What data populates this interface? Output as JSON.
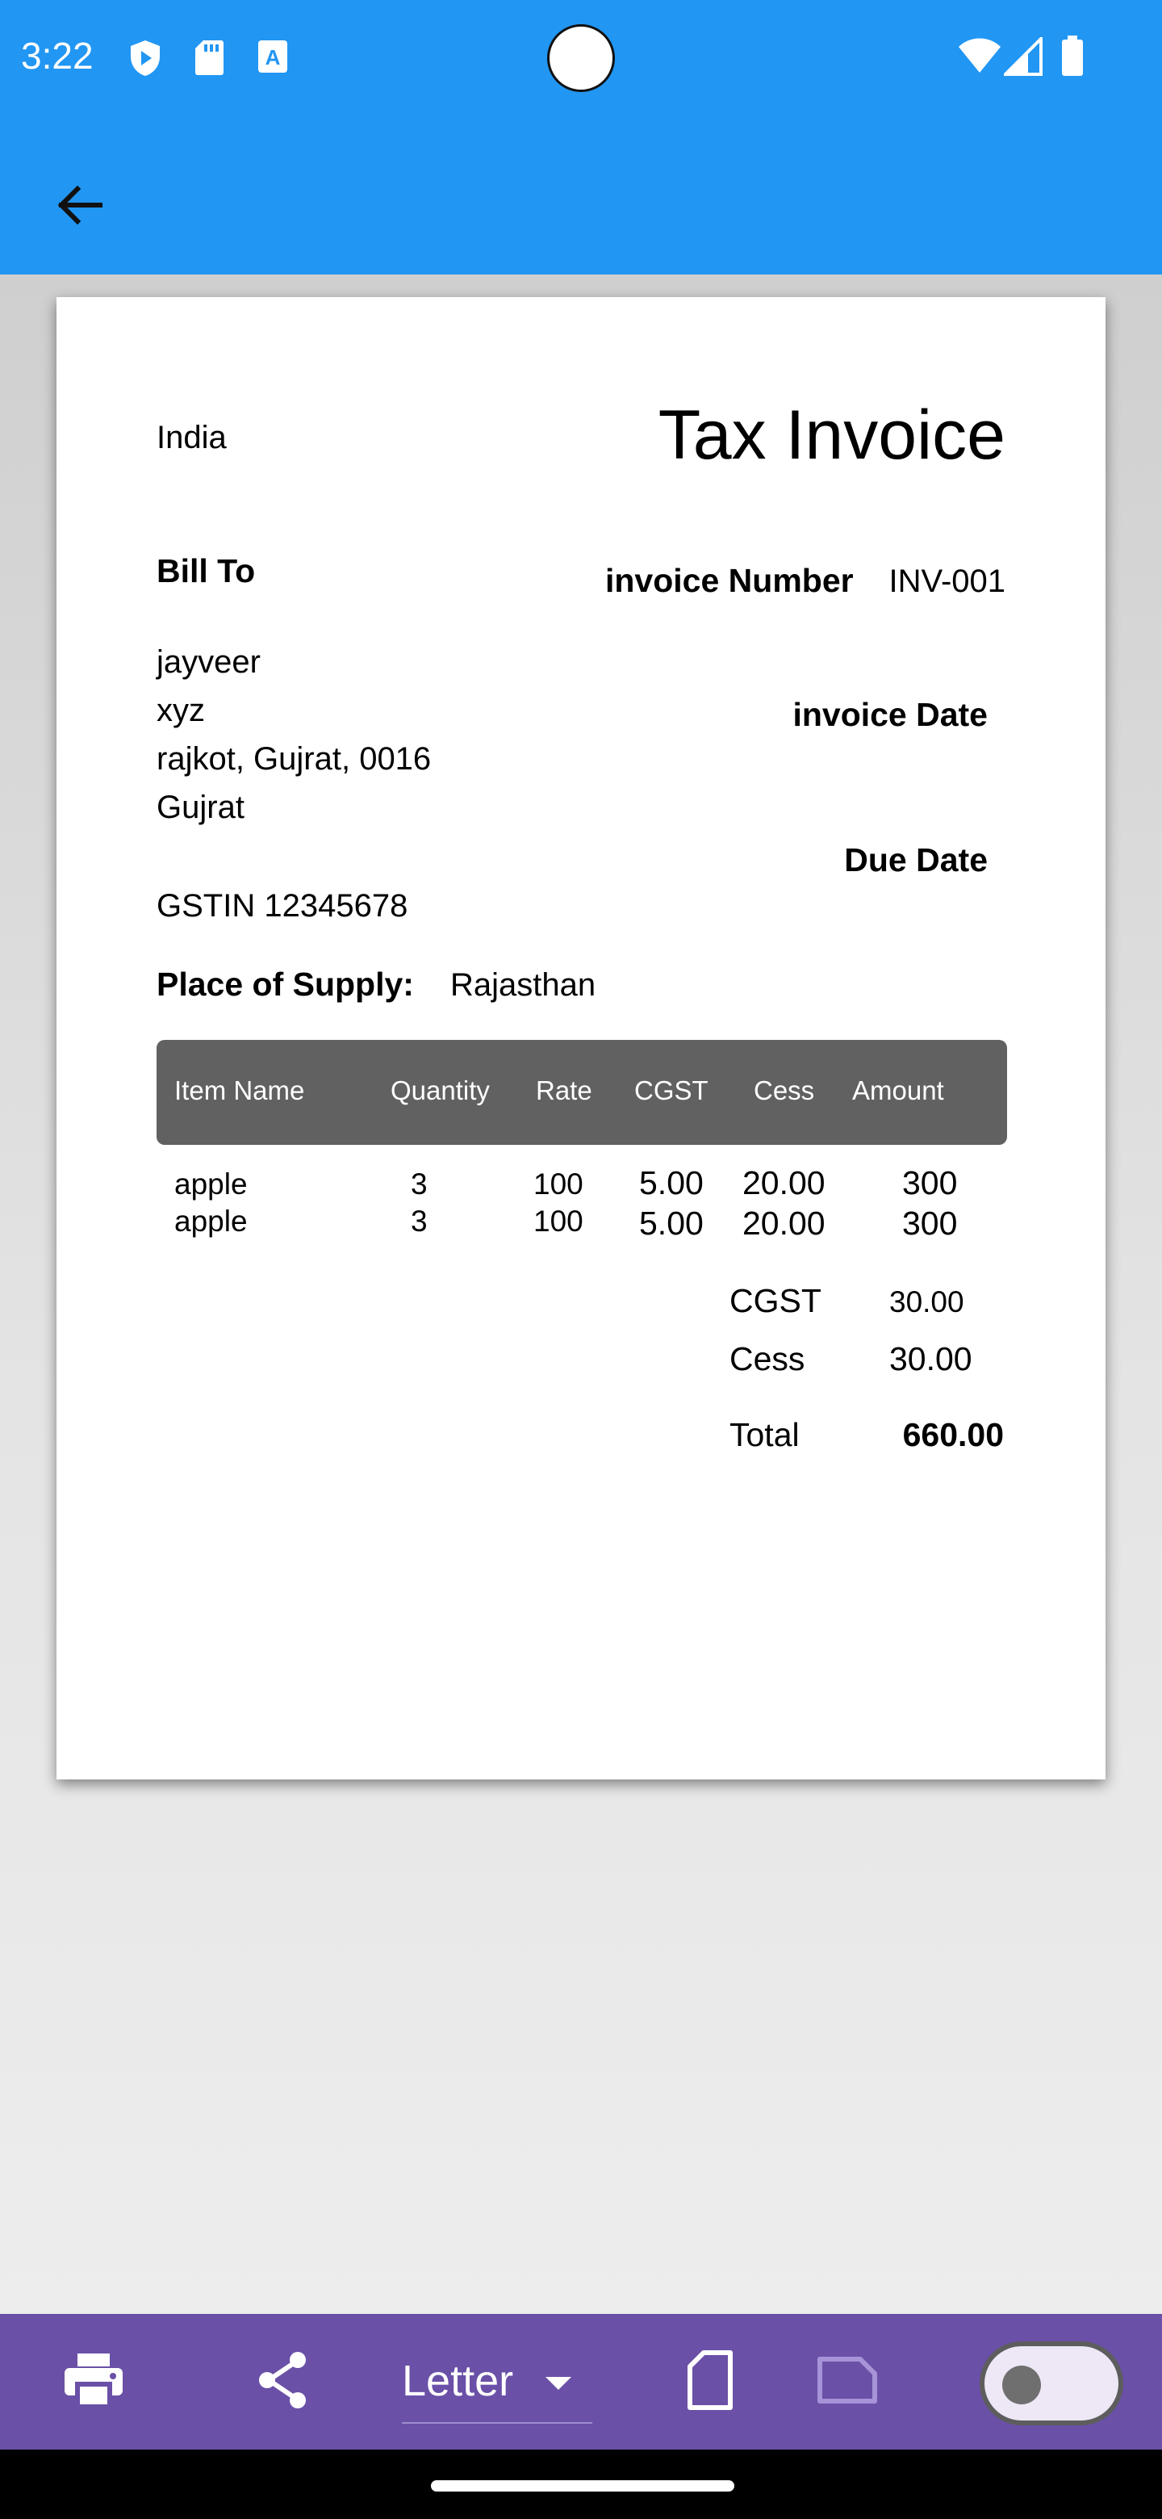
{
  "status_bar": {
    "time": "3:22",
    "icons": [
      "play-protect-icon",
      "sd-card-icon",
      "keyboard-a-icon",
      "wifi-icon",
      "cellular-icon",
      "battery-icon"
    ]
  },
  "app_bar": {
    "back_icon": "arrow-back-icon",
    "color": "#2196f3"
  },
  "invoice": {
    "country": "India",
    "title": "Tax Invoice",
    "bill_to_label": "Bill To",
    "invoice_number_label": "invoice Number",
    "invoice_number": "INV-001",
    "address_lines": [
      "jayveer",
      "xyz",
      "rajkot, Gujrat, 0016",
      "Gujrat"
    ],
    "invoice_date_label": "invoice Date",
    "due_date_label": "Due Date",
    "gstin": "GSTIN 12345678",
    "place_of_supply_label": "Place of Supply:",
    "place_of_supply": "Rajasthan",
    "table": {
      "columns": [
        "Item Name",
        "Quantity",
        "Rate",
        "CGST",
        "Cess",
        "Amount"
      ],
      "rows": [
        [
          "apple",
          "3",
          "100",
          "5.00",
          "20.00",
          "300"
        ],
        [
          "apple",
          "3",
          "100",
          "5.00",
          "20.00",
          "300"
        ]
      ]
    },
    "totals": {
      "cgst_label": "CGST",
      "cgst_value": "30.00",
      "cess_label": "Cess",
      "cess_value": "30.00",
      "total_label": "Total",
      "total_value": "660.00"
    }
  },
  "toolbar": {
    "print_icon": "print-icon",
    "share_icon": "share-icon",
    "paper_size": "Letter",
    "portrait_icon": "portrait-page-icon",
    "landscape_icon": "landscape-page-icon",
    "toggle_state": "off",
    "color": "#6a50a7"
  }
}
